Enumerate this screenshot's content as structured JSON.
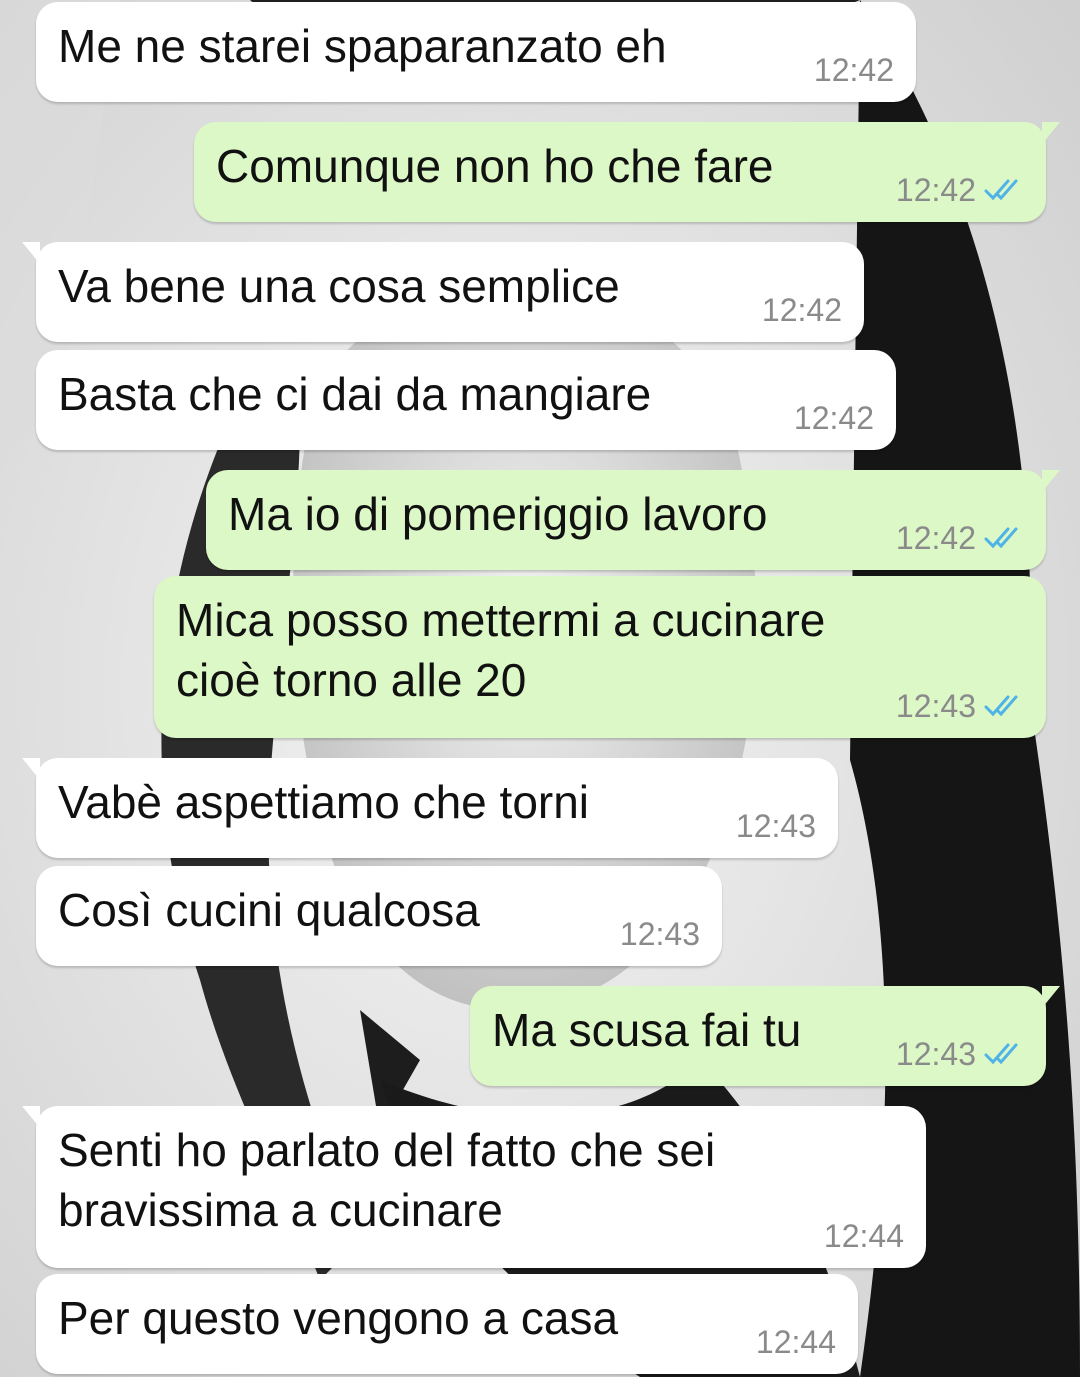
{
  "theme": {
    "incoming_bubble": "#ffffff",
    "outgoing_bubble": "#dcf8c6",
    "read_ticks_color": "#4fb3e8",
    "timestamp_color": "#8a8a8a"
  },
  "messages": [
    {
      "direction": "incoming",
      "text": "Me ne starei spaparanzato eh",
      "time": "12:42",
      "status": null
    },
    {
      "direction": "outgoing",
      "text": "Comunque non ho che fare",
      "time": "12:42",
      "status": "read"
    },
    {
      "direction": "incoming",
      "text": "Va bene una cosa semplice",
      "time": "12:42",
      "status": null
    },
    {
      "direction": "incoming",
      "text": "Basta che ci dai da mangiare",
      "time": "12:42",
      "status": null
    },
    {
      "direction": "outgoing",
      "text": "Ma io di pomeriggio lavoro",
      "time": "12:42",
      "status": "read"
    },
    {
      "direction": "outgoing",
      "text": "Mica posso mettermi a cucinare\ncioè torno alle 20",
      "time": "12:43",
      "status": "read"
    },
    {
      "direction": "incoming",
      "text": "Vabè aspettiamo che torni",
      "time": "12:43",
      "status": null
    },
    {
      "direction": "incoming",
      "text": "Così cucini qualcosa",
      "time": "12:43",
      "status": null
    },
    {
      "direction": "outgoing",
      "text": "Ma scusa fai tu",
      "time": "12:43",
      "status": "read"
    },
    {
      "direction": "incoming",
      "text": "Senti ho parlato del fatto che sei\nbravissima a cucinare",
      "time": "12:44",
      "status": null
    },
    {
      "direction": "incoming",
      "text": "Per questo vengono a casa",
      "time": "12:44",
      "status": null
    }
  ]
}
